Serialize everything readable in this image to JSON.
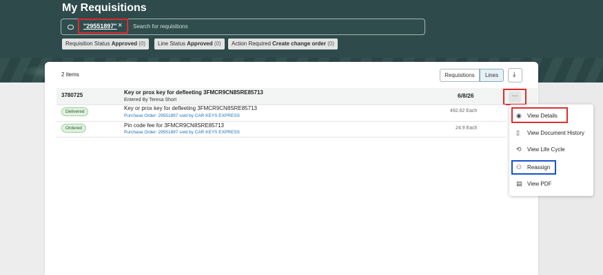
{
  "page": {
    "title": "My Requisitions"
  },
  "search": {
    "chip": "\"29551897\"",
    "chip_close": "×",
    "placeholder": "Search for requisitions"
  },
  "filters": [
    {
      "prefix": "Requisition Status",
      "value": "Approved",
      "count": "(0)"
    },
    {
      "prefix": "Line Status",
      "value": "Approved",
      "count": "(0)"
    },
    {
      "prefix": "Action Required",
      "value": "Create change order",
      "count": "(0)"
    }
  ],
  "toolbar": {
    "items_count": "2 items",
    "view_requisitions": "Requisitions",
    "view_lines": "Lines",
    "download_icon": "⤓"
  },
  "requisition": {
    "number": "3780725",
    "title": "Key or prox key for defleeting 3FMCR9CN8SRE85713",
    "entered_by": "Entered By Teresa Short",
    "date": "6/8/26",
    "more": "···"
  },
  "lines": [
    {
      "status": "Delivered",
      "title": "Key or prox key for defleeting 3FMCR9CN8SRE85713",
      "po": "Purchase Order: 29551897 sold by CAR KEYS EXPRESS",
      "price": "492.62 Each"
    },
    {
      "status": "Ordered",
      "title": "Pin code fee for 3FMCR9CN8SRE85713",
      "po": "Purchase Order: 29551897 sold by CAR KEYS EXPRESS",
      "price": "24.9 Each"
    }
  ],
  "menu": [
    {
      "label": "View Details",
      "icon": "eye-icon",
      "glyph": "◉"
    },
    {
      "label": "View Document History",
      "icon": "document-history-icon",
      "glyph": "▯"
    },
    {
      "label": "View Life Cycle",
      "icon": "cycle-icon",
      "glyph": "⟲"
    },
    {
      "label": "Reassign",
      "icon": "reassign-user-icon",
      "glyph": "⚇"
    },
    {
      "label": "View PDF",
      "icon": "pdf-document-icon",
      "glyph": "▤"
    }
  ],
  "colors": {
    "header": "#2f4a4b",
    "highlight_red": "#e02a2a",
    "highlight_blue": "#1450c9",
    "link": "#1f6fb5"
  }
}
